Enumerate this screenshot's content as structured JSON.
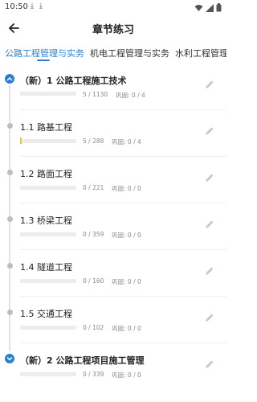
{
  "status_bar": {
    "time": "10:50",
    "left_icons": "⤓ ⤓"
  },
  "app_bar": {
    "title": "章节练习"
  },
  "tabs": [
    {
      "label": "公路工程管理与实务",
      "active": true
    },
    {
      "label": "机电工程管理与实务",
      "active": false
    },
    {
      "label": "水利工程管理",
      "active": false
    }
  ],
  "accent_color": "#2a7fd4",
  "items": [
    {
      "title": "（新）1 公路工程施工技术",
      "type": "chapter",
      "expanded": true,
      "answered": "5 / 1130",
      "review": "巩固: 0 / 4",
      "progress_fraction": 0.0
    },
    {
      "title": "1.1 路基工程",
      "type": "section",
      "answered": "5 / 288",
      "review": "巩固: 0 / 4",
      "progress_fraction": 0.02
    },
    {
      "title": "1.2 路面工程",
      "type": "section",
      "answered": "0 / 221",
      "review": "巩固: 0 / 0",
      "progress_fraction": 0.0
    },
    {
      "title": "1.3 桥梁工程",
      "type": "section",
      "answered": "0 / 359",
      "review": "巩固: 0 / 0",
      "progress_fraction": 0.0
    },
    {
      "title": "1.4 隧道工程",
      "type": "section",
      "answered": "0 / 160",
      "review": "巩固: 0 / 0",
      "progress_fraction": 0.0
    },
    {
      "title": "1.5 交通工程",
      "type": "section",
      "answered": "0 / 102",
      "review": "巩固: 0 / 0",
      "progress_fraction": 0.0
    },
    {
      "title": "（新）2 公路工程项目施工管理",
      "type": "chapter",
      "expanded": false,
      "answered": "0 / 339",
      "review": "巩固: 0 / 0",
      "progress_fraction": 0.0
    }
  ]
}
